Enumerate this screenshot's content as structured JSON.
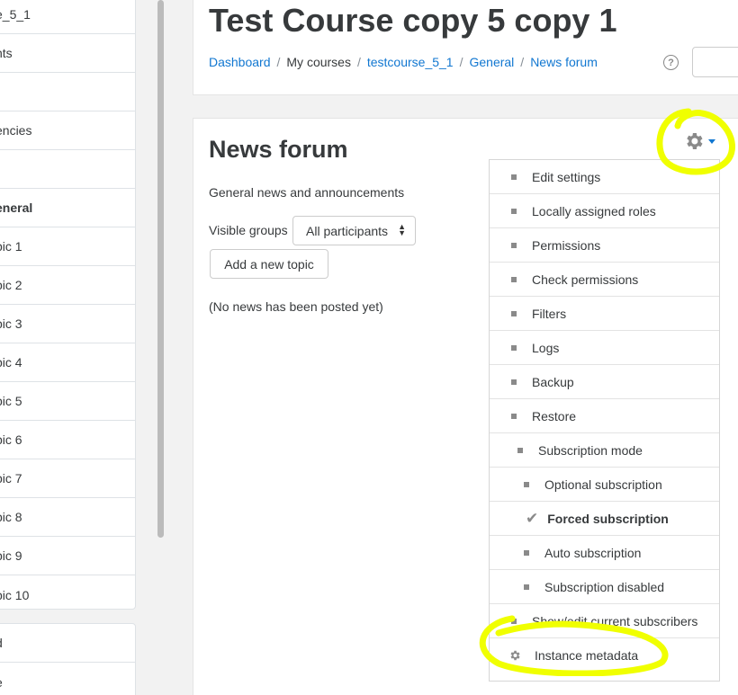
{
  "sidebar": {
    "items": [
      {
        "label": "e_5_1",
        "bold": false
      },
      {
        "label": "nts",
        "bold": false
      },
      {
        "label": "",
        "bold": false
      },
      {
        "label": "encies",
        "bold": false
      },
      {
        "label": "",
        "bold": false
      },
      {
        "label": "eneral",
        "bold": true
      },
      {
        "label": "pic 1",
        "bold": false
      },
      {
        "label": "pic 2",
        "bold": false
      },
      {
        "label": "pic 3",
        "bold": false
      },
      {
        "label": "pic 4",
        "bold": false
      },
      {
        "label": "pic 5",
        "bold": false
      },
      {
        "label": "pic 6",
        "bold": false
      },
      {
        "label": "pic 7",
        "bold": false
      },
      {
        "label": "pic 8",
        "bold": false
      },
      {
        "label": "pic 9",
        "bold": false
      },
      {
        "label": "pic 10",
        "bold": false
      }
    ],
    "bottom_items": [
      {
        "label": "d"
      },
      {
        "label": "e"
      }
    ]
  },
  "header": {
    "course_title": "Test Course copy 5 copy 1",
    "breadcrumb": [
      {
        "label": "Dashboard",
        "link": true
      },
      {
        "label": "My courses",
        "link": false
      },
      {
        "label": "testcourse_5_1",
        "link": true
      },
      {
        "label": "General",
        "link": true
      },
      {
        "label": "News forum",
        "link": true
      }
    ],
    "help_icon": "question-circle-icon"
  },
  "main": {
    "title": "News forum",
    "intro": "General news and announcements",
    "groups_label": "Visible groups",
    "groups_selected": "All participants",
    "add_topic_label": "Add a new topic",
    "no_news": "(No news has been posted yet)"
  },
  "menu": {
    "icon": "gear-icon",
    "items": [
      {
        "label": "Edit settings",
        "indent": 0,
        "type": "bullet"
      },
      {
        "label": "Locally assigned roles",
        "indent": 0,
        "type": "bullet"
      },
      {
        "label": "Permissions",
        "indent": 0,
        "type": "bullet"
      },
      {
        "label": "Check permissions",
        "indent": 0,
        "type": "bullet"
      },
      {
        "label": "Filters",
        "indent": 0,
        "type": "bullet"
      },
      {
        "label": "Logs",
        "indent": 0,
        "type": "bullet"
      },
      {
        "label": "Backup",
        "indent": 0,
        "type": "bullet"
      },
      {
        "label": "Restore",
        "indent": 0,
        "type": "bullet"
      },
      {
        "label": "Subscription mode",
        "indent": 1,
        "type": "bullet"
      },
      {
        "label": "Optional subscription",
        "indent": 2,
        "type": "bullet"
      },
      {
        "label": "Forced subscription",
        "indent": 2,
        "type": "check"
      },
      {
        "label": "Auto subscription",
        "indent": 2,
        "type": "bullet"
      },
      {
        "label": "Subscription disabled",
        "indent": 2,
        "type": "bullet"
      },
      {
        "label": "Show/edit current subscribers",
        "indent": 0,
        "type": "bullet"
      },
      {
        "label": "Instance metadata",
        "indent": 0,
        "type": "gear"
      }
    ]
  },
  "colors": {
    "link": "#1177d1",
    "highlight": "#f0ff00"
  }
}
